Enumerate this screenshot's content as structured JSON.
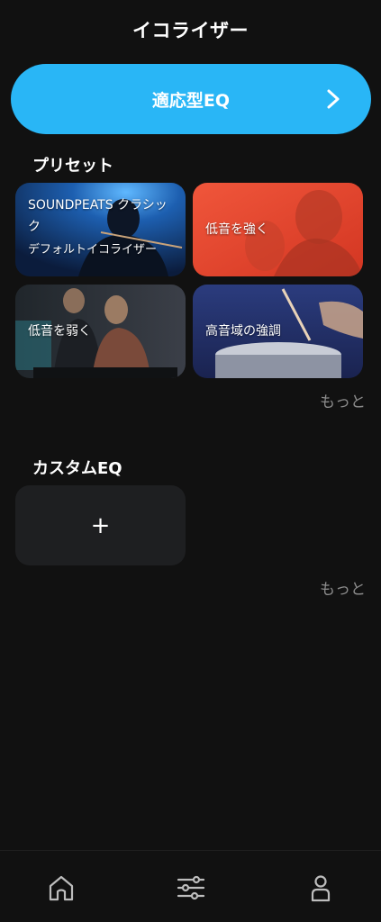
{
  "header": {
    "title": "イコライザー"
  },
  "adaptive": {
    "label": "適応型EQ",
    "icon": "chevron-right-icon"
  },
  "presets": {
    "title": "プリセット",
    "items": [
      {
        "line1": "SOUNDPEATS クラシッ",
        "line2": "ク",
        "line3": "デフォルトイコライザー",
        "theme": "#1b4e8a"
      },
      {
        "line1": "低音を強く",
        "theme": "#e8412c"
      },
      {
        "line1": "低音を弱く",
        "theme": "#3a3a3e"
      },
      {
        "line1": "高音域の強調",
        "theme": "#2a3a72"
      }
    ],
    "more": "もっと"
  },
  "custom": {
    "title": "カスタムEQ",
    "add_symbol": "+",
    "more": "もっと"
  },
  "nav": {
    "items": [
      {
        "icon": "home-icon"
      },
      {
        "icon": "equalizer-sliders-icon"
      },
      {
        "icon": "profile-icon"
      }
    ]
  }
}
